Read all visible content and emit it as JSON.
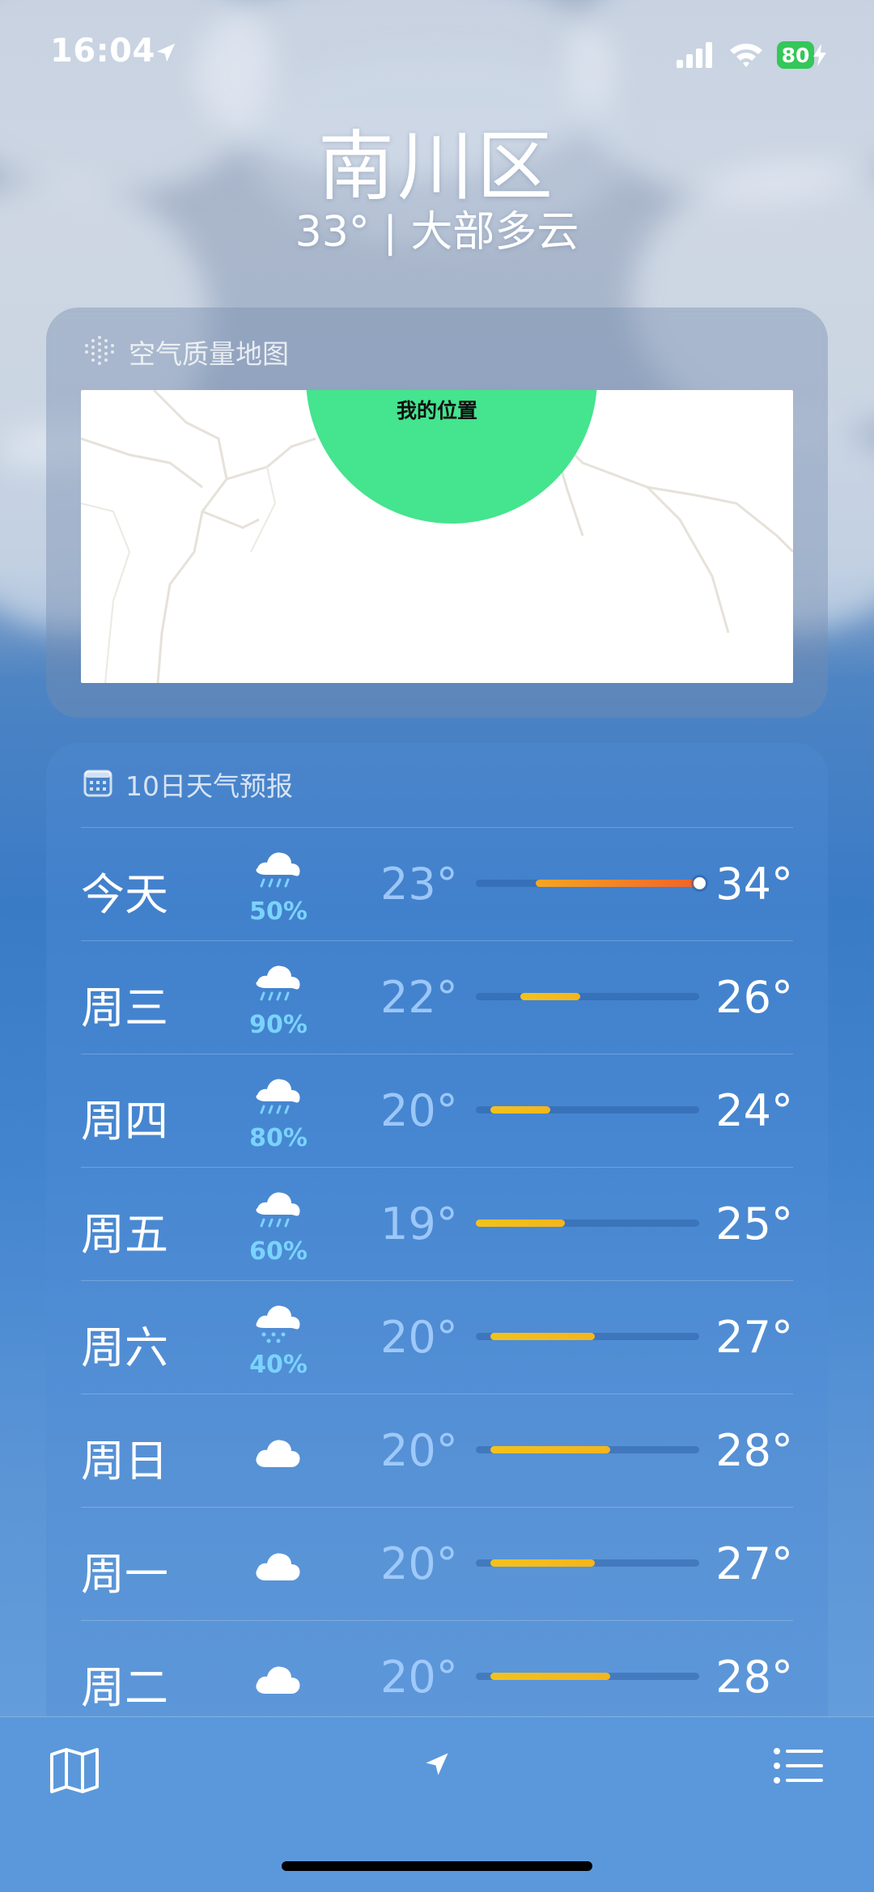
{
  "status_bar": {
    "time": "16:04",
    "battery": "80",
    "battery_color": "#34c759"
  },
  "location": {
    "name": "南川区",
    "current_summary": "33° | 大部多云"
  },
  "air_quality": {
    "title": "空气质量地图",
    "icon": "dotted-circle-icon",
    "my_location_label": "我的位置",
    "blob_color": "#45e48f"
  },
  "forecast": {
    "title": "10日天气预报",
    "icon": "calendar-icon",
    "scale": {
      "min": 19,
      "max": 34
    },
    "days": [
      {
        "day": "今天",
        "icon": "cloud-rain-icon",
        "precip": "50%",
        "low": "23°",
        "high": "34°",
        "low_val": 23,
        "high_val": 34,
        "current_val": 34,
        "color": "orange"
      },
      {
        "day": "周三",
        "icon": "cloud-rain-icon",
        "precip": "90%",
        "low": "22°",
        "high": "26°",
        "low_val": 22,
        "high_val": 26,
        "color": "yellow"
      },
      {
        "day": "周四",
        "icon": "cloud-rain-icon",
        "precip": "80%",
        "low": "20°",
        "high": "24°",
        "low_val": 20,
        "high_val": 24,
        "color": "yellow"
      },
      {
        "day": "周五",
        "icon": "cloud-rain-icon",
        "precip": "60%",
        "low": "19°",
        "high": "25°",
        "low_val": 19,
        "high_val": 25,
        "color": "yellow"
      },
      {
        "day": "周六",
        "icon": "cloud-drizzle-icon",
        "precip": "40%",
        "low": "20°",
        "high": "27°",
        "low_val": 20,
        "high_val": 27,
        "color": "yellow"
      },
      {
        "day": "周日",
        "icon": "cloud-icon",
        "precip": "",
        "low": "20°",
        "high": "28°",
        "low_val": 20,
        "high_val": 28,
        "color": "yellow"
      },
      {
        "day": "周一",
        "icon": "cloud-icon",
        "precip": "",
        "low": "20°",
        "high": "27°",
        "low_val": 20,
        "high_val": 27,
        "color": "yellow"
      },
      {
        "day": "周二",
        "icon": "cloud-icon",
        "precip": "",
        "low": "20°",
        "high": "28°",
        "low_val": 20,
        "high_val": 28,
        "color": "yellow"
      }
    ]
  },
  "toolbar": {
    "map_icon": "map-icon",
    "location_icon": "location-arrow-icon",
    "list_icon": "list-icon"
  }
}
